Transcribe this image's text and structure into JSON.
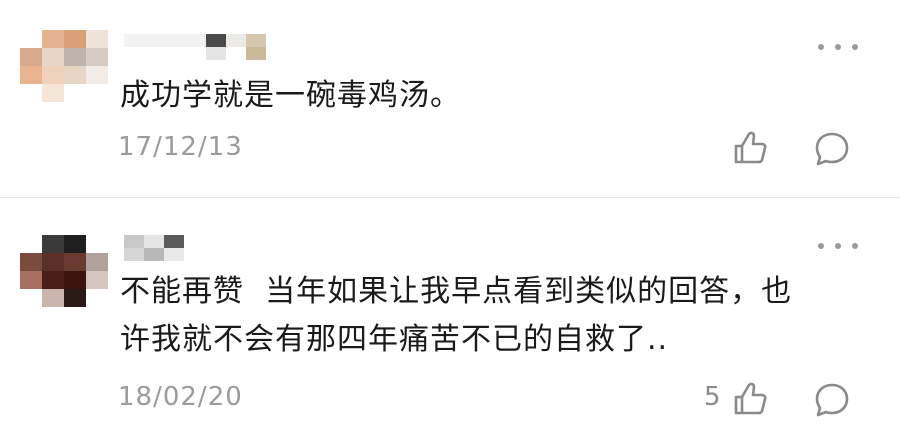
{
  "comments": [
    {
      "text": "成功学就是一碗毒鸡汤。",
      "date": "17/12/13",
      "likes": "",
      "avatar_icon": "blurred-avatar-icon",
      "more_icon": "more-dots-icon",
      "like_icon": "thumbs-up-icon",
      "reply_icon": "speech-bubble-icon"
    },
    {
      "text": "不能再赞  当年如果让我早点看到类似的回答，也\n许我就不会有那四年痛苦不已的自救了..",
      "date": "18/02/20",
      "likes": "5",
      "avatar_icon": "blurred-avatar-icon",
      "more_icon": "more-dots-icon",
      "like_icon": "thumbs-up-icon",
      "reply_icon": "speech-bubble-icon"
    }
  ],
  "colors": {
    "text": "#1a1a1a",
    "meta": "#9b9b9b",
    "icon": "#8a8a8a",
    "divider": "#e6e6e6"
  }
}
